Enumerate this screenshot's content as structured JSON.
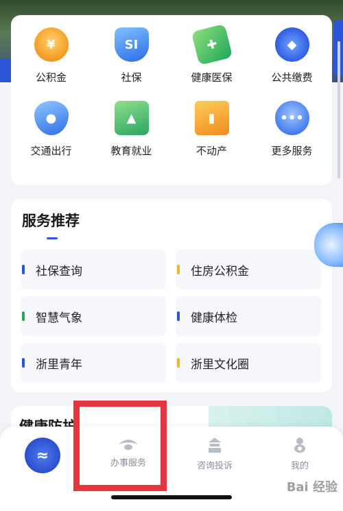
{
  "services": [
    {
      "label": "公积金",
      "icon": "coin-icon",
      "glyph": "¥",
      "cls": "ic-gjj"
    },
    {
      "label": "社保",
      "icon": "shield-icon",
      "glyph": "SI",
      "cls": "ic-sb"
    },
    {
      "label": "健康医保",
      "icon": "health-card-icon",
      "glyph": "✚",
      "cls": "ic-jk"
    },
    {
      "label": "公共缴费",
      "icon": "payment-icon",
      "glyph": "◆",
      "cls": "ic-gj"
    },
    {
      "label": "交通出行",
      "icon": "location-pin-icon",
      "glyph": "●",
      "cls": "ic-jt"
    },
    {
      "label": "教育就业",
      "icon": "graduation-cap-icon",
      "glyph": "▲",
      "cls": "ic-jy"
    },
    {
      "label": "不动产",
      "icon": "building-icon",
      "glyph": "▮",
      "cls": "ic-bdc"
    },
    {
      "label": "更多服务",
      "icon": "more-icon",
      "glyph": "•••",
      "cls": "ic-gd"
    }
  ],
  "recommend": {
    "title": "服务推荐",
    "items": [
      {
        "label": "社保查询",
        "color": "#2c55d8"
      },
      {
        "label": "住房公积金",
        "color": "#f0b429"
      },
      {
        "label": "智慧气象",
        "color": "#2aa463"
      },
      {
        "label": "健康体检",
        "color": "#2c55d8"
      },
      {
        "label": "浙里青年",
        "color": "#2c55d8"
      },
      {
        "label": "浙里文化圈",
        "color": "#f0b429"
      }
    ]
  },
  "peek": {
    "title": "健康防护"
  },
  "tabbar": {
    "tabs": [
      {
        "label": "办事服务",
        "icon": "service-icon"
      },
      {
        "label": "咨询投诉",
        "icon": "consult-icon"
      },
      {
        "label": "我的",
        "icon": "user-icon"
      }
    ]
  },
  "watermark": "Bai 经验"
}
